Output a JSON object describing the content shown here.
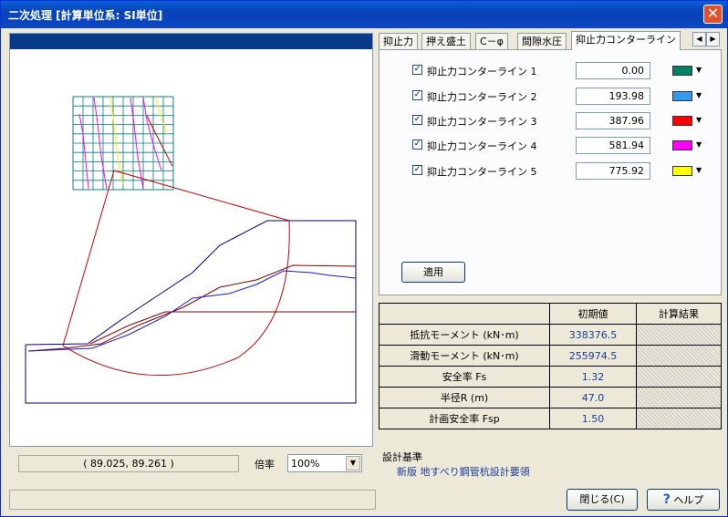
{
  "window": {
    "title": "二次処理 [計算単位系: SI単位]",
    "close_label": "✕"
  },
  "tabs": [
    "抑止力",
    "押え盛土",
    "C－φ",
    "間隙水圧",
    "抑止力コンターライン"
  ],
  "tab_scroll": {
    "left": "◀",
    "right": "▶"
  },
  "contours": [
    {
      "checked": "✓",
      "label": "抑止力コンターライン 1",
      "value": "0.00",
      "color": "#008066"
    },
    {
      "checked": "✓",
      "label": "抑止力コンターライン 2",
      "value": "193.98",
      "color": "#3399ee"
    },
    {
      "checked": "✓",
      "label": "抑止力コンターライン 3",
      "value": "387.96",
      "color": "#ff0000"
    },
    {
      "checked": "✓",
      "label": "抑止力コンターライン 4",
      "value": "581.94",
      "color": "#ff00ff"
    },
    {
      "checked": "✓",
      "label": "抑止力コンターライン 5",
      "value": "775.92",
      "color": "#ffff00"
    }
  ],
  "apply_label": "適用",
  "results": {
    "headers": [
      "",
      "初期値",
      "計算結果"
    ],
    "rows": [
      {
        "label": "抵抗モーメント (kN･m)",
        "initial": "338376.5",
        "result": ""
      },
      {
        "label": "滑動モーメント (kN･m)",
        "initial": "255974.5",
        "result": ""
      },
      {
        "label": "安全率 Fs",
        "initial": "1.32",
        "result": ""
      },
      {
        "label": "半径R (m)",
        "initial": "47.0",
        "result": ""
      },
      {
        "label": "計画安全率 Fsp",
        "initial": "1.50",
        "result": ""
      }
    ]
  },
  "design_standard": {
    "label": "設計基準",
    "value": "新版 地すべり鋼管杭設計要領"
  },
  "coordinates": "(   89.025,   89.261 )",
  "zoom": {
    "label": "倍率",
    "value": "100%"
  },
  "buttons": {
    "close": "閉じる(C)",
    "help": "ヘルプ",
    "help_icon": "?"
  },
  "colors": {
    "title_bar": "#0843b8",
    "panel_bar": "#0a3a8a",
    "slope_outline": "#000080",
    "slip_circle": "#cc0000"
  }
}
